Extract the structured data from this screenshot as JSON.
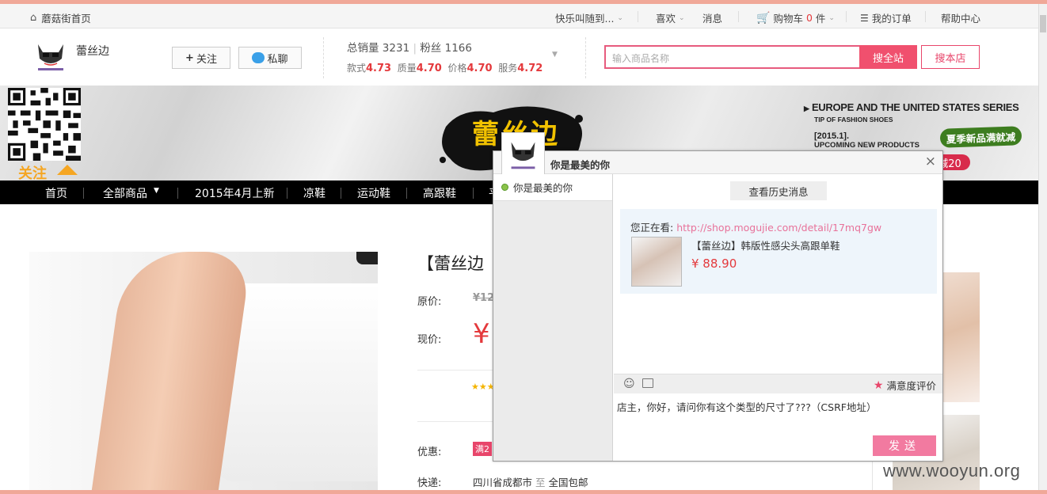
{
  "topbar": {
    "home": "蘑菇街首页",
    "random": "快乐叫随到...",
    "likes": "喜欢",
    "messages": "消息",
    "cart_label": "购物车",
    "cart_count": "0",
    "cart_unit": "件",
    "orders": "我的订单",
    "help": "帮助中心"
  },
  "shop": {
    "name": "蕾丝边",
    "follow_btn": "关注",
    "chat_btn": "私聊",
    "sales_label": "总销量",
    "sales_value": "3231",
    "fans_label": "粉丝",
    "fans_value": "1166",
    "ratings": [
      {
        "label": "款式",
        "value": "4.73"
      },
      {
        "label": "质量",
        "value": "4.70"
      },
      {
        "label": "价格",
        "value": "4.70"
      },
      {
        "label": "服务",
        "value": "4.72"
      }
    ]
  },
  "search": {
    "placeholder": "输入商品名称",
    "all_btn": "搜全站",
    "shop_btn": "搜本店"
  },
  "banner": {
    "follow": "关注",
    "brand": "蕾丝边",
    "series_line1": "EUROPE AND THE UNITED STATES SERIES",
    "series_line2": "TIP OF FASHION SHOES",
    "series_line3": "[2015.1].",
    "series_line4": "UPCOMING NEW PRODUCTS",
    "promo_green": "夏季新品满就减",
    "promo_red": "减20"
  },
  "nav": {
    "items": [
      "首页",
      "全部商品",
      "2015年4月上新",
      "凉鞋",
      "运动鞋",
      "高跟鞋",
      "平"
    ]
  },
  "product": {
    "title_partial": "【蕾丝边",
    "orig_label": "原价:",
    "orig_price": "¥12",
    "cur_label": "现价:",
    "cur_symbol": "¥",
    "promo_label": "优惠:",
    "promo_tag": "满2",
    "ship_label": "快递:",
    "ship_from": "四川省成都市",
    "ship_to_word": "至",
    "ship_to": "全国包邮"
  },
  "chat": {
    "title": "你是最美的你",
    "contact": "你是最美的你",
    "history_btn": "查看历史消息",
    "viewing_label": "您正在看:",
    "viewing_url": "http://shop.mogujie.com/detail/17mq7gw",
    "product_name": "【蕾丝边】韩版性感尖头高跟单鞋",
    "product_price": "¥ 88.90",
    "rating_label": "满意度评价",
    "input_text": "店主，你好，请问你有这个类型的尺寸了???（CSRF地址）",
    "send_btn": "发送"
  },
  "watermark": "www.wooyun.org",
  "colors": {
    "accent": "#f0506e",
    "price": "#e4393c",
    "send": "#f27aa0",
    "nav_bg": "#000000"
  }
}
